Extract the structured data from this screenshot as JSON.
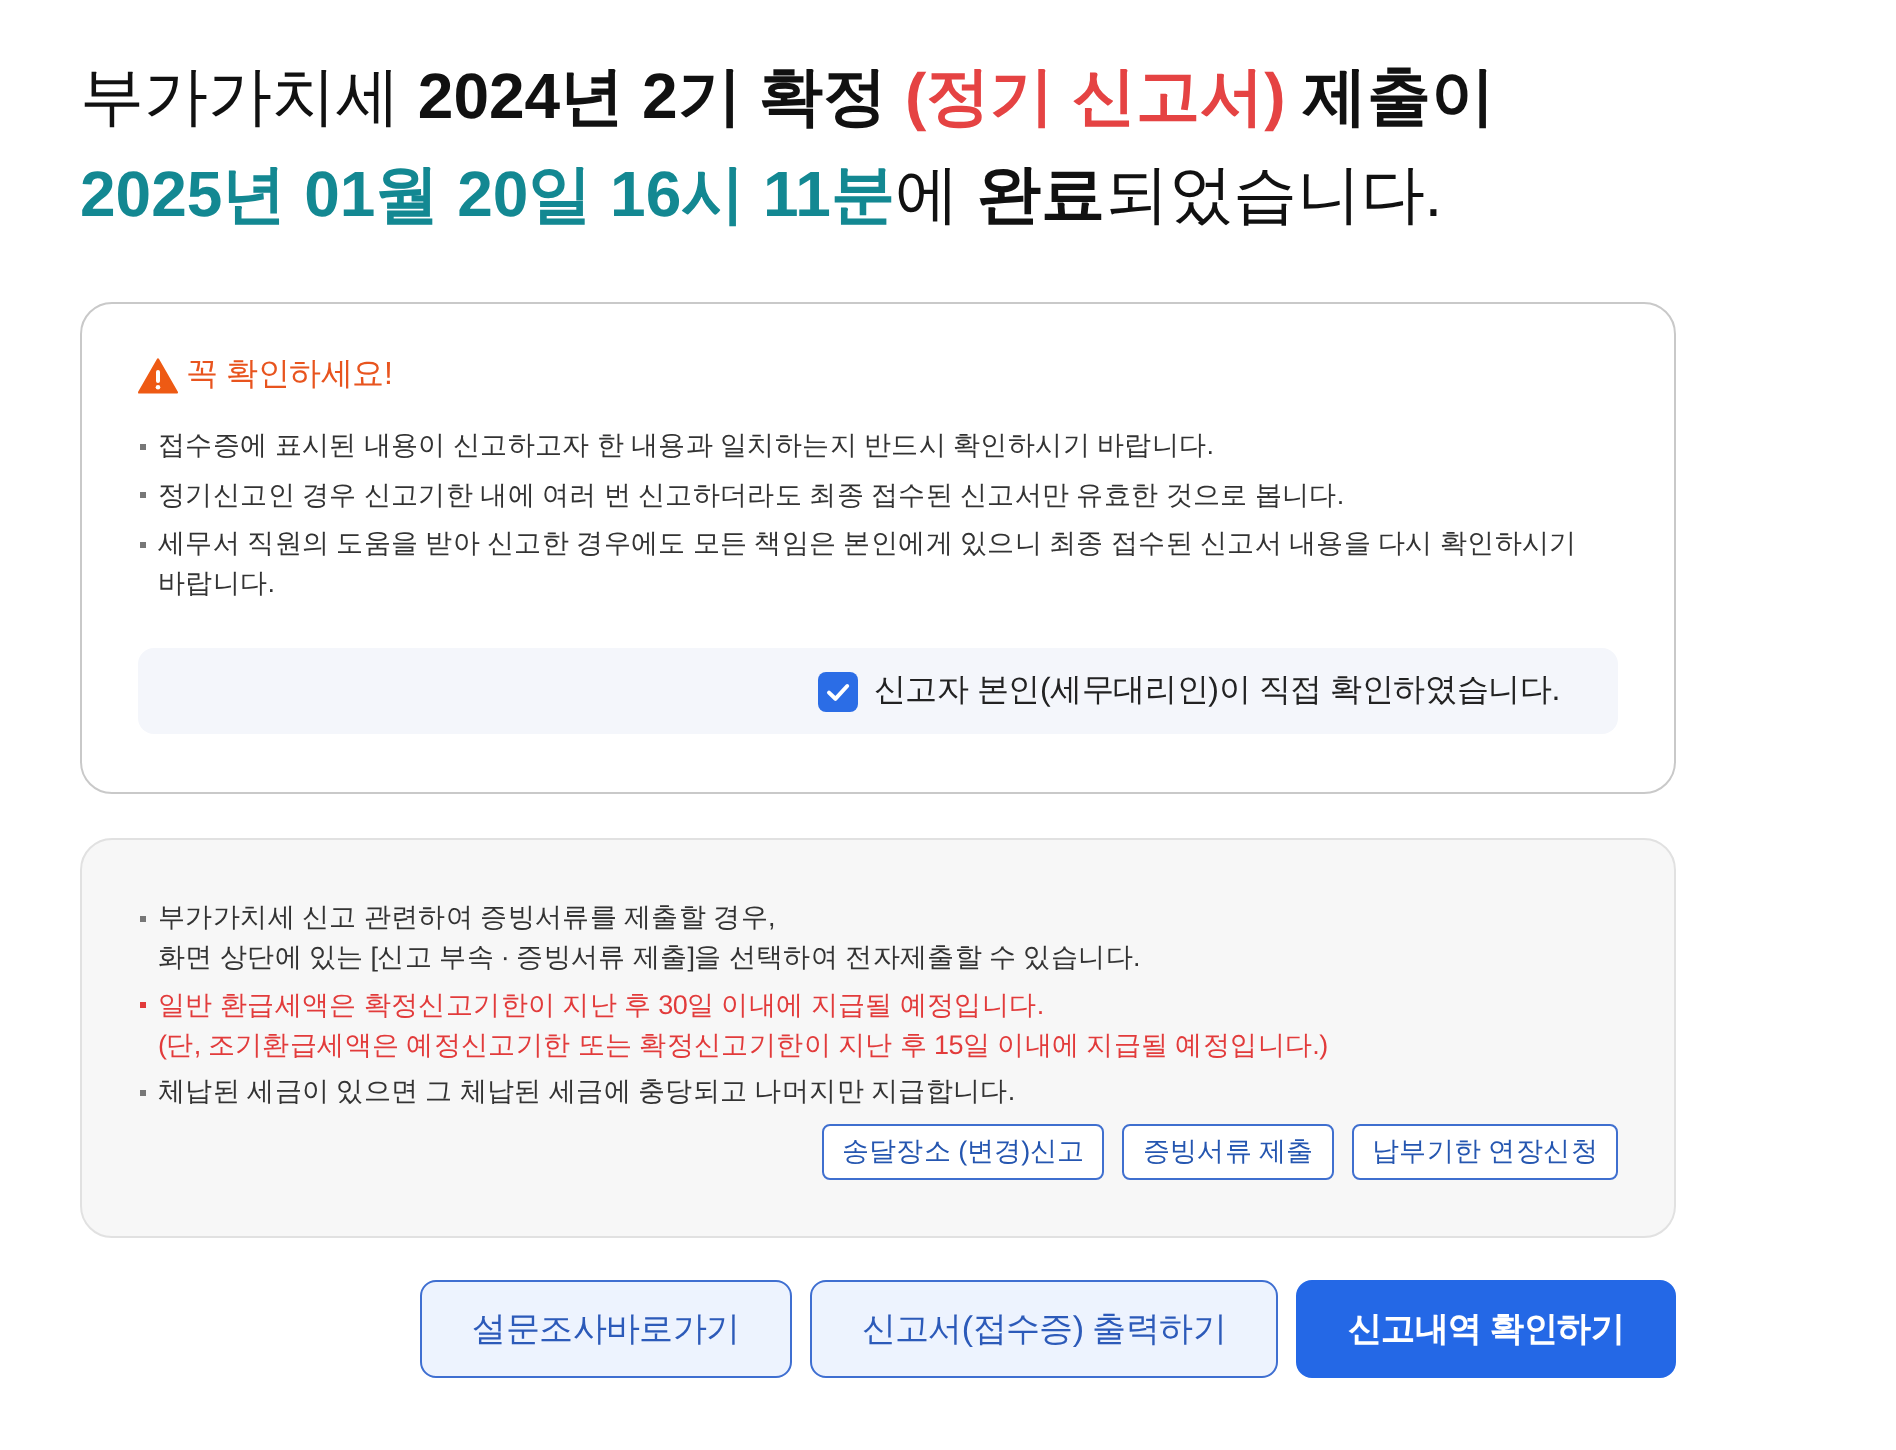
{
  "heading": {
    "lines": [
      [
        {
          "text": "부가가치세 ",
          "kind": "normal"
        },
        {
          "text": "2024년 2기 확정 ",
          "kind": "strong"
        },
        {
          "text": "(정기 신고서)",
          "kind": "alert"
        },
        {
          "text": " 제출이",
          "kind": "strong"
        }
      ],
      [
        {
          "text": "2025년 01월 20일 16시 11분",
          "kind": "highlight"
        },
        {
          "text": "에 ",
          "kind": "normal"
        },
        {
          "text": "완료",
          "kind": "strong"
        },
        {
          "text": "되었습니다.",
          "kind": "normal"
        }
      ]
    ]
  },
  "notice": {
    "title": "꼭 확인하세요!",
    "items": [
      "접수증에 표시된 내용이 신고하고자 한 내용과 일치하는지 반드시 확인하시기 바랍니다.",
      "정기신고인 경우 신고기한 내에 여러 번 신고하더라도 최종 접수된 신고서만 유효한 것으로 봅니다.",
      "세무서 직원의 도움을 받아 신고한 경우에도 모든 책임은 본인에게 있으니 최종 접수된 신고서 내용을 다시 확인하시기 바랍니다."
    ],
    "confirmation": {
      "label": "신고자 본인(세무대리인)이 직접 확인하였습니다.",
      "checked": true
    }
  },
  "info": {
    "items": [
      {
        "kind": "note",
        "lines": [
          "부가가치세 신고 관련하여 증빙서류를 제출할 경우,",
          "화면 상단에 있는 [신고 부속 · 증빙서류 제출]을 선택하여 전자제출할 수 있습니다."
        ]
      },
      {
        "kind": "warning",
        "lines": [
          "일반 환급세액은 확정신고기한이 지난 후 30일 이내에 지급될 예정입니다.",
          "(단, 조기환급세액은 예정신고기한 또는 확정신고기한이 지난 후 15일 이내에 지급될 예정입니다.)"
        ]
      },
      {
        "kind": "note",
        "lines": [
          "체납된 세금이 있으면 그 체납된 세금에 충당되고 나머지만 지급합니다."
        ]
      }
    ],
    "buttons": [
      "송달장소 (변경)신고",
      "증빙서류 제출",
      "납부기한 연장신청"
    ]
  },
  "actions": [
    {
      "label": "설문조사바로가기",
      "kind": "secondary"
    },
    {
      "label": "신고서(접수증) 출력하기",
      "kind": "secondary"
    },
    {
      "label": "신고내역 확인하기",
      "kind": "primary"
    }
  ]
}
